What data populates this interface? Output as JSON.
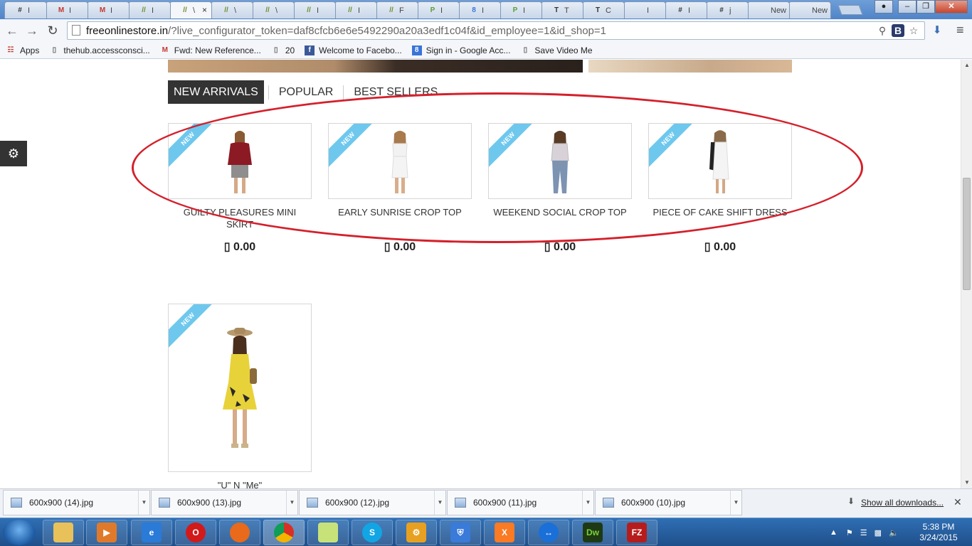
{
  "browser": {
    "tabs": [
      {
        "title": "I",
        "icon": "#",
        "color": "#333"
      },
      {
        "title": "I",
        "icon": "M",
        "color": "#c5382d"
      },
      {
        "title": "I",
        "icon": "M",
        "color": "#c5382d"
      },
      {
        "title": "I",
        "icon": "//",
        "color": "#6a8d2a"
      },
      {
        "title": "\\",
        "icon": "//",
        "color": "#6a8d2a"
      },
      {
        "title": "\\",
        "icon": "//",
        "color": "#6a8d2a"
      },
      {
        "title": "\\",
        "icon": "//",
        "color": "#6a8d2a"
      },
      {
        "title": "I",
        "icon": "//",
        "color": "#6a8d2a"
      },
      {
        "title": "I",
        "icon": "//",
        "color": "#6a8d2a"
      },
      {
        "title": "F",
        "icon": "//",
        "color": "#6a8d2a"
      },
      {
        "title": "I",
        "icon": "P",
        "color": "#5d9c3a"
      },
      {
        "title": "I",
        "icon": "8",
        "color": "#3a74d8"
      },
      {
        "title": "I",
        "icon": "P",
        "color": "#5d9c3a"
      },
      {
        "title": "T",
        "icon": "T",
        "color": "#333"
      },
      {
        "title": "C",
        "icon": "T",
        "color": "#333"
      },
      {
        "title": "I",
        "icon": "",
        "color": "#777"
      },
      {
        "title": "I",
        "icon": "#",
        "color": "#333"
      },
      {
        "title": "j",
        "icon": "#",
        "color": "#333"
      },
      {
        "title": "New",
        "icon": "",
        "color": "#777"
      },
      {
        "title": "New",
        "icon": "",
        "color": "#777"
      }
    ],
    "address": {
      "domain": "freeonlinestore.in",
      "rest": "/?live_configurator_token=daf8cfcb6e6e5492290a20a3edf1c04f&id_employee=1&id_shop=1"
    },
    "bookmarks": [
      {
        "label": "Apps",
        "icon": "apps-icon"
      },
      {
        "label": "thehub.accessconsci...",
        "icon": "page-icon"
      },
      {
        "label": "Fwd: New Reference...",
        "icon": "gmail-icon"
      },
      {
        "label": "20",
        "icon": "page-icon"
      },
      {
        "label": "Welcome to Facebo...",
        "icon": "facebook-icon"
      },
      {
        "label": "Sign in - Google Acc...",
        "icon": "google-icon"
      },
      {
        "label": "Save Video Me",
        "icon": "page-icon"
      }
    ]
  },
  "store": {
    "tabs": [
      "NEW ARRIVALS",
      "POPULAR",
      "BEST SELLERS"
    ],
    "ribbon": "NEW",
    "products": [
      {
        "name": "GUILTY PLEASURES MINI SKIRT",
        "price": "▯ 0.00"
      },
      {
        "name": "EARLY SUNRISE CROP TOP",
        "price": "▯ 0.00"
      },
      {
        "name": "WEEKEND SOCIAL CROP TOP",
        "price": "▯ 0.00"
      },
      {
        "name": "PIECE OF CAKE SHIFT DRESS",
        "price": "▯ 0.00"
      },
      {
        "name": "\"U\" N \"Me\"",
        "price": ""
      }
    ]
  },
  "downloads": {
    "items": [
      "600x900 (14).jpg",
      "600x900 (13).jpg",
      "600x900 (12).jpg",
      "600x900 (11).jpg",
      "600x900 (10).jpg"
    ],
    "show_all": "Show all downloads..."
  },
  "taskbar": {
    "time": "5:38 PM",
    "date": "3/24/2015"
  }
}
